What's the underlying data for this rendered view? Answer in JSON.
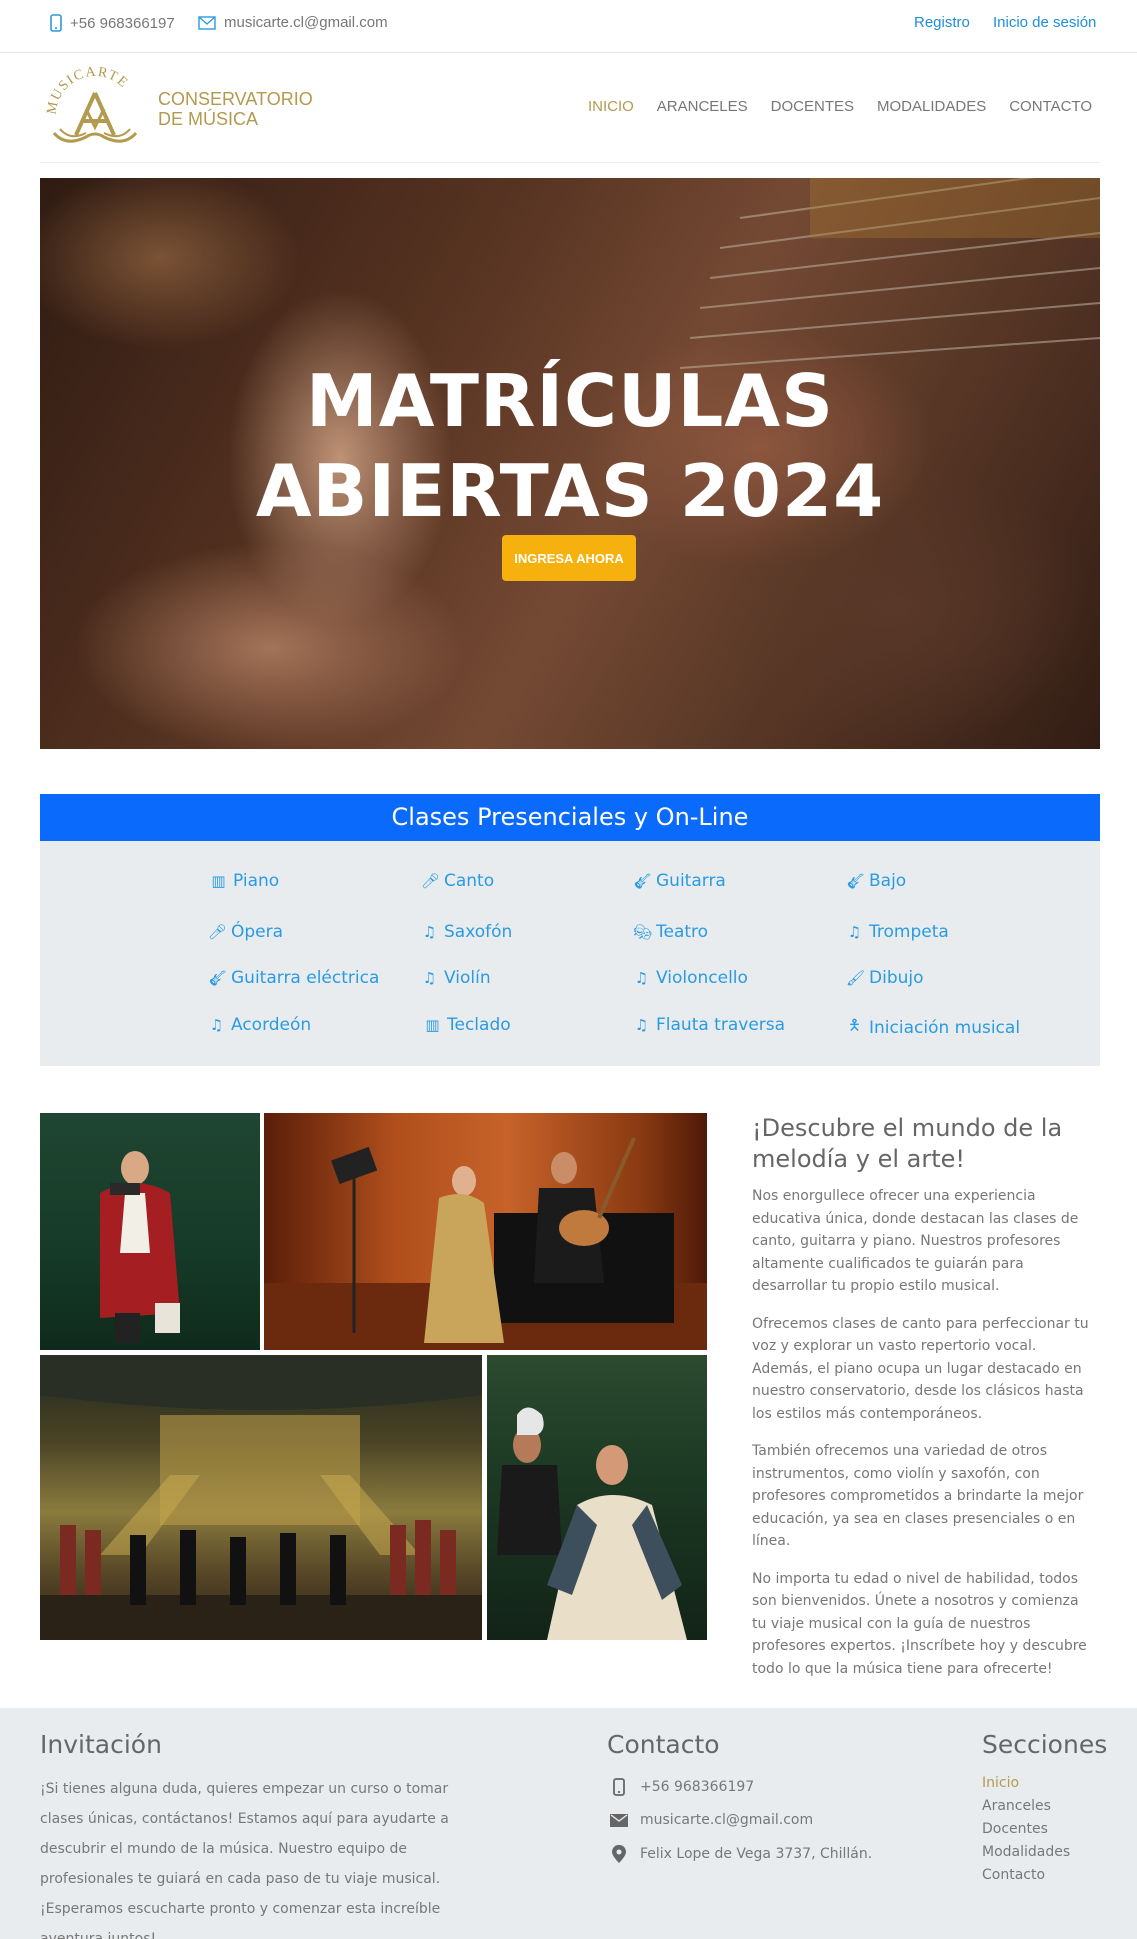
{
  "topbar": {
    "phone": "+56 968366197",
    "email": "musicarte.cl@gmail.com",
    "register": "Registro",
    "login": "Inicio de sesión"
  },
  "header": {
    "logo_text": "MUSICARTE",
    "brand_line1": "CONSERVATORIO",
    "brand_line2": "DE MÚSICA",
    "nav": [
      "INICIO",
      "ARANCELES",
      "DOCENTES",
      "MODALIDADES",
      "CONTACTO"
    ],
    "active_nav": "INICIO"
  },
  "hero": {
    "title_line1": "MATRÍCULAS",
    "title_line2": "ABIERTAS 2024",
    "cta": "INGRESA AHORA"
  },
  "classes": {
    "heading": "Clases Presenciales y On-Line",
    "items": [
      {
        "label": "Piano",
        "icon": "piano-keys-icon"
      },
      {
        "label": "Canto",
        "icon": "microphone-icon"
      },
      {
        "label": "Guitarra",
        "icon": "guitar-icon"
      },
      {
        "label": "Bajo",
        "icon": "guitar-icon"
      },
      {
        "label": "Ópera",
        "icon": "microphone-icon"
      },
      {
        "label": "Saxofón",
        "icon": "music-note-icon"
      },
      {
        "label": "Teatro",
        "icon": "theater-masks-icon"
      },
      {
        "label": "Trompeta",
        "icon": "music-note-icon"
      },
      {
        "label": "Guitarra eléctrica",
        "icon": "guitar-icon"
      },
      {
        "label": "Violín",
        "icon": "music-note-icon"
      },
      {
        "label": "Violoncello",
        "icon": "music-note-icon"
      },
      {
        "label": "Dibujo",
        "icon": "paint-brush-icon"
      },
      {
        "label": "Acordeón",
        "icon": "music-note-icon"
      },
      {
        "label": "Teclado",
        "icon": "piano-keys-icon"
      },
      {
        "label": "Flauta traversa",
        "icon": "music-note-icon"
      },
      {
        "label": "Iniciación musical",
        "icon": "child-icon"
      }
    ]
  },
  "intro": {
    "heading": "¡Descubre el mundo de la melodía y el arte!",
    "paragraphs": [
      "Nos enorgullece ofrecer una experiencia educativa única, donde destacan las clases de canto, guitarra y piano. Nuestros profesores altamente cualificados te guiarán para desarrollar tu propio estilo musical.",
      "Ofrecemos clases de canto para perfeccionar tu voz y explorar un vasto repertorio vocal. Además, el piano ocupa un lugar destacado en nuestro conservatorio, desde los clásicos hasta los estilos más contemporáneos.",
      "También ofrecemos una variedad de otros instrumentos, como violín y saxofón, con profesores comprometidos a brindarte la mejor educación, ya sea en clases presenciales o en línea.",
      "No importa tu edad o nivel de habilidad, todos son bienvenidos. Únete a nosotros y comienza tu viaje musical con la guía de nuestros profesores expertos. ¡Inscríbete hoy y descubre todo lo que la música tiene para ofrecerte!"
    ]
  },
  "footer": {
    "invitation_title": "Invitación",
    "invitation_text": "¡Si tienes alguna duda, quieres empezar un curso o tomar clases únicas, contáctanos! Estamos aquí para ayudarte a descubrir el mundo de la música. Nuestro equipo de profesionales te guiará en cada paso de tu viaje musical. ¡Esperamos escucharte pronto y comenzar esta increíble aventura juntos!",
    "contact_title": "Contacto",
    "contact_phone": "+56 968366197",
    "contact_email": "musicarte.cl@gmail.com",
    "contact_address": "Felix Lope de Vega 3737, Chillán.",
    "sections_title": "Secciones",
    "sections": [
      "Inicio",
      "Aranceles",
      "Docentes",
      "Modalidades",
      "Contacto"
    ]
  },
  "colors": {
    "gold": "#b29a4f",
    "link_blue": "#2a9be0",
    "banner_blue": "#0a6afc",
    "cta_yellow": "#f7b10e",
    "panel_gray": "#e9ecef"
  }
}
